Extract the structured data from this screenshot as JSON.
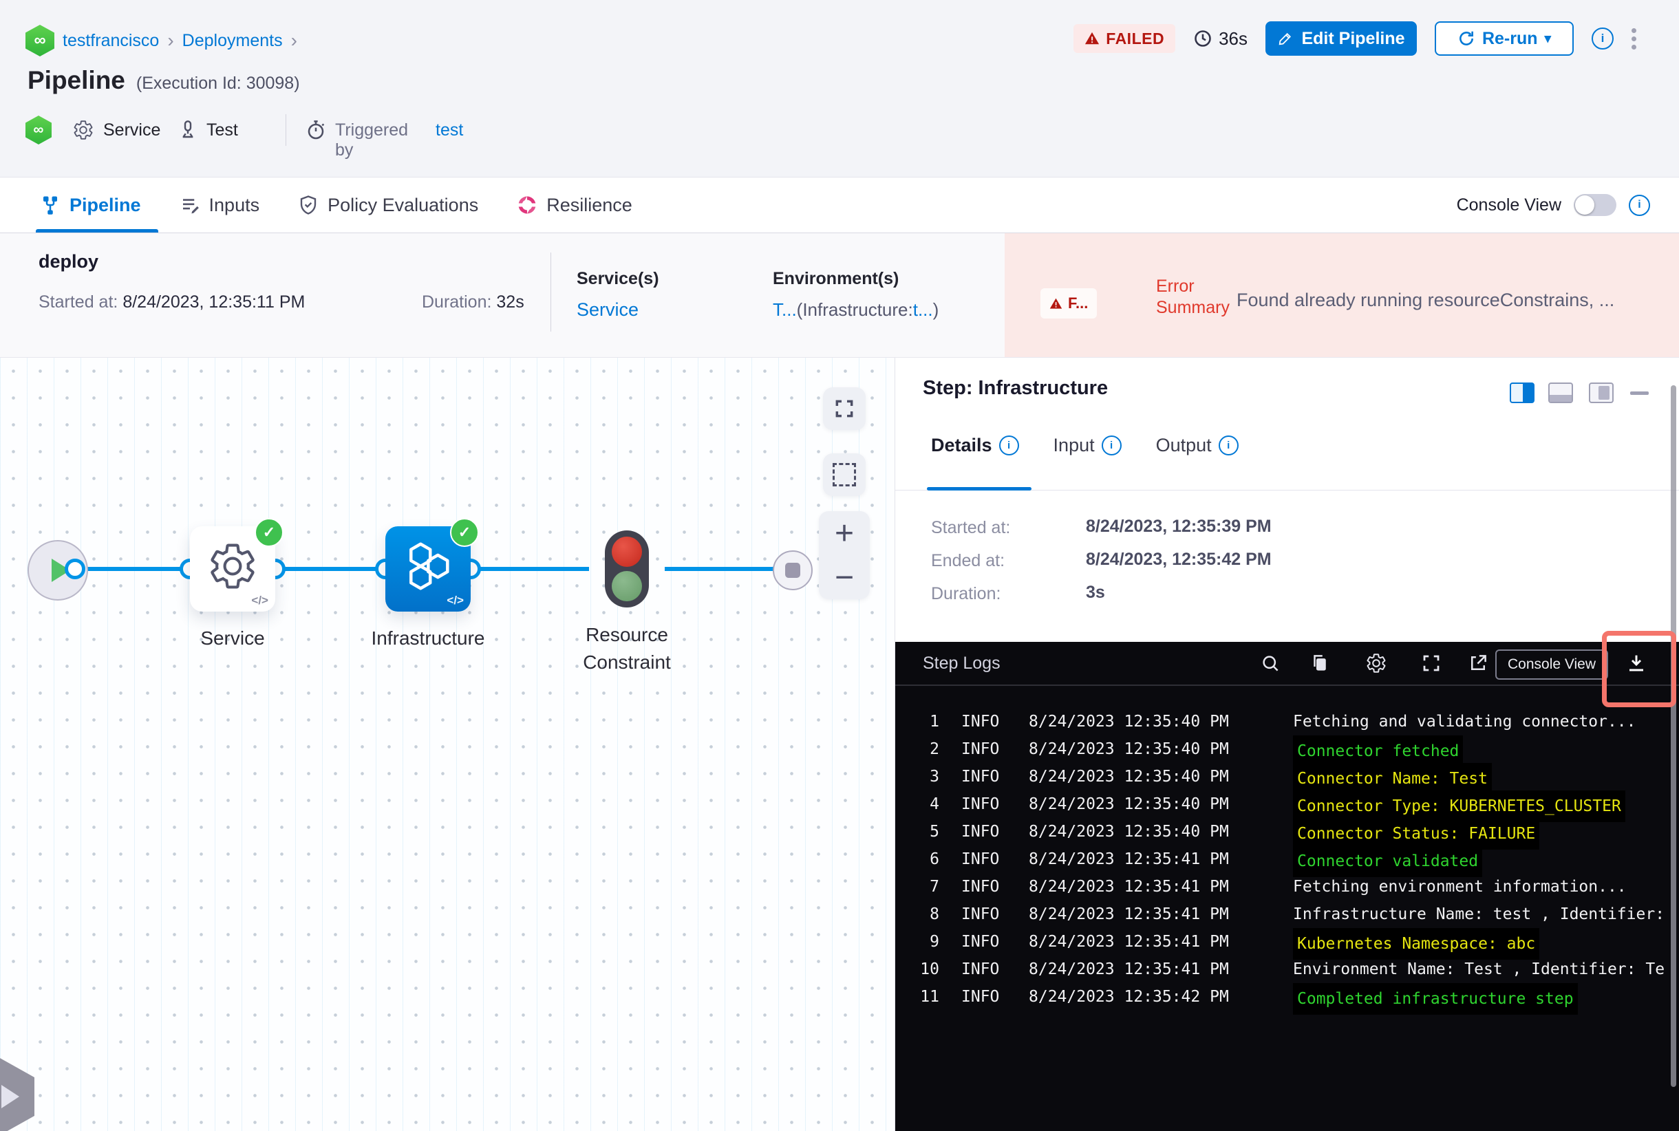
{
  "colors": {
    "primary_blue": "#0278D5",
    "failed_red": "#B41710",
    "error_pink_bg": "#FBE9E7",
    "success_green": "#3FC14F",
    "log_green": "#2FD42F",
    "log_yellow": "#E5E510",
    "resilience_pink": "#E0367C",
    "highlight_red": "#F4756B",
    "node_blue": "#0283DC"
  },
  "icons": {
    "infinity": "∞",
    "chevron": "›",
    "caret_down": "▾",
    "check": "✓",
    "plus": "+",
    "minus": "−",
    "code_tag": "</>"
  },
  "breadcrumb": {
    "project": "testfrancisco",
    "section": "Deployments"
  },
  "header": {
    "title": "Pipeline",
    "execution_id": "(Execution Id: 30098)",
    "status_badge": "FAILED",
    "total_duration": "36s",
    "edit_pipeline_label": "Edit Pipeline",
    "rerun_label": "Re-run",
    "service_label": "Service",
    "environment_label": "Test",
    "triggered_by_label": "Triggered by",
    "triggered_by_user": "test"
  },
  "tabs": {
    "pipeline": "Pipeline",
    "inputs": "Inputs",
    "policy": "Policy Evaluations",
    "resilience": "Resilience",
    "console_view_label": "Console View"
  },
  "stage": {
    "name": "deploy",
    "started_label": "Started at:",
    "started_value": "8/24/2023, 12:35:11 PM",
    "duration_label": "Duration:",
    "duration_value": "32s",
    "services_label": "Service(s)",
    "service_link": "Service",
    "environments_label": "Environment(s)",
    "environment_value_primary": "T...",
    "environment_value_infra_label": "(Infrastructure:",
    "environment_value_infra": "t...",
    "environment_value_close": ")",
    "error_badge": "F...",
    "error_label": "Error Summary",
    "error_message": "Found already running resourceConstrains, ..."
  },
  "graph": {
    "node_service": "Service",
    "node_infrastructure": "Infrastructure",
    "node_resource_constraint_line1": "Resource",
    "node_resource_constraint_line2": "Constraint"
  },
  "step_panel": {
    "title": "Step: Infrastructure",
    "tab_details": "Details",
    "tab_input": "Input",
    "tab_output": "Output",
    "details": [
      {
        "label": "Started at:",
        "value": "8/24/2023, 12:35:39 PM"
      },
      {
        "label": "Ended at:",
        "value": "8/24/2023, 12:35:42 PM"
      },
      {
        "label": "Duration:",
        "value": "3s"
      }
    ]
  },
  "logs": {
    "title": "Step Logs",
    "console_view_button": "Console View",
    "lines": [
      {
        "num": "1",
        "level": "INFO",
        "time": "8/24/2023 12:35:40 PM",
        "message": "Fetching and validating connector...",
        "color": "white"
      },
      {
        "num": "2",
        "level": "INFO",
        "time": "8/24/2023 12:35:40 PM",
        "message": "Connector fetched",
        "color": "green"
      },
      {
        "num": "3",
        "level": "INFO",
        "time": "8/24/2023 12:35:40 PM",
        "message": "Connector Name: Test",
        "color": "yellow"
      },
      {
        "num": "4",
        "level": "INFO",
        "time": "8/24/2023 12:35:40 PM",
        "message": "Connector Type: KUBERNETES_CLUSTER",
        "color": "yellow"
      },
      {
        "num": "5",
        "level": "INFO",
        "time": "8/24/2023 12:35:40 PM",
        "message": "Connector Status: FAILURE",
        "color": "yellow"
      },
      {
        "num": "6",
        "level": "INFO",
        "time": "8/24/2023 12:35:41 PM",
        "message": "Connector validated",
        "color": "green"
      },
      {
        "num": "7",
        "level": "INFO",
        "time": "8/24/2023 12:35:41 PM",
        "message": "Fetching environment information...",
        "color": "white"
      },
      {
        "num": "8",
        "level": "INFO",
        "time": "8/24/2023 12:35:41 PM",
        "message": "Infrastructure Name: test , Identifier:",
        "color": "white"
      },
      {
        "num": "9",
        "level": "INFO",
        "time": "8/24/2023 12:35:41 PM",
        "message": "Kubernetes Namespace: abc",
        "color": "yellow"
      },
      {
        "num": "10",
        "level": "INFO",
        "time": "8/24/2023 12:35:41 PM",
        "message": "Environment Name: Test , Identifier: Te",
        "color": "white"
      },
      {
        "num": "11",
        "level": "INFO",
        "time": "8/24/2023 12:35:42 PM",
        "message": "Completed infrastructure step",
        "color": "green"
      }
    ]
  }
}
